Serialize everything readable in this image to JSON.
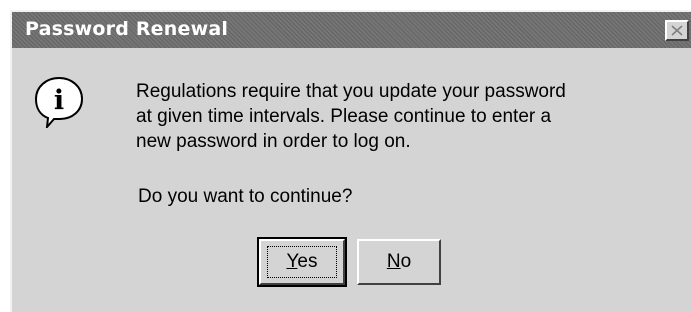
{
  "window": {
    "title": "Password Renewal",
    "close_label": "Close"
  },
  "icon": {
    "name": "info-icon",
    "glyph": "i"
  },
  "message": {
    "lines": [
      "Regulations require that you update your password",
      "at given time intervals. Please continue to enter a",
      "new password in order to log on."
    ],
    "question": "Do you want to continue?"
  },
  "buttons": {
    "yes": {
      "accel": "Y",
      "rest": "es"
    },
    "no": {
      "accel": "N",
      "rest": "o"
    }
  },
  "colors": {
    "face": "#d4d4d4",
    "titlebar": "#767676",
    "title_text": "#ffffff"
  }
}
